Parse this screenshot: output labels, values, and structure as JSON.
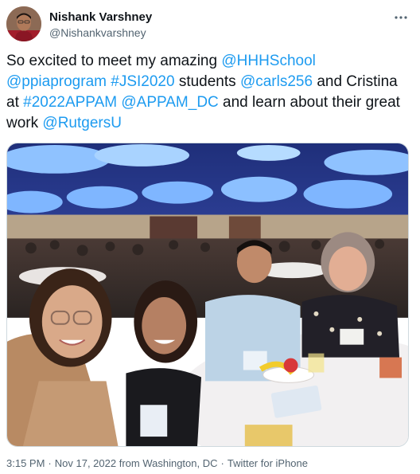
{
  "user": {
    "display_name": "Nishank Varshney",
    "handle": "@Nishankvarshney",
    "avatar": "profile-photo"
  },
  "tweet": {
    "segments": [
      {
        "text": "So excited to meet my amazing ",
        "link": false
      },
      {
        "text": "@HHHSchool",
        "link": true
      },
      {
        "text": " ",
        "link": false
      },
      {
        "text": "@ppiaprogram",
        "link": true
      },
      {
        "text": " ",
        "link": false
      },
      {
        "text": "#JSI2020",
        "link": true
      },
      {
        "text": " students ",
        "link": false
      },
      {
        "text": "@carls256",
        "link": true
      },
      {
        "text": " and Cristina at ",
        "link": false
      },
      {
        "text": "#2022APPAM",
        "link": true
      },
      {
        "text": " ",
        "link": false
      },
      {
        "text": "@APPAM_DC",
        "link": true
      },
      {
        "text": " and learn about their great work ",
        "link": false
      },
      {
        "text": "@RutgersU",
        "link": true
      }
    ],
    "image": "group-selfie-at-conference-banquet-hall"
  },
  "meta": {
    "time": "3:15 PM",
    "date": "Nov 17, 2022 from Washington, DC",
    "source": "Twitter for iPhone",
    "separator": "·"
  },
  "icons": {
    "more": "more-horizontal-icon"
  },
  "colors": {
    "link": "#1d9bf0",
    "secondary": "#536471",
    "text": "#0f1419"
  }
}
